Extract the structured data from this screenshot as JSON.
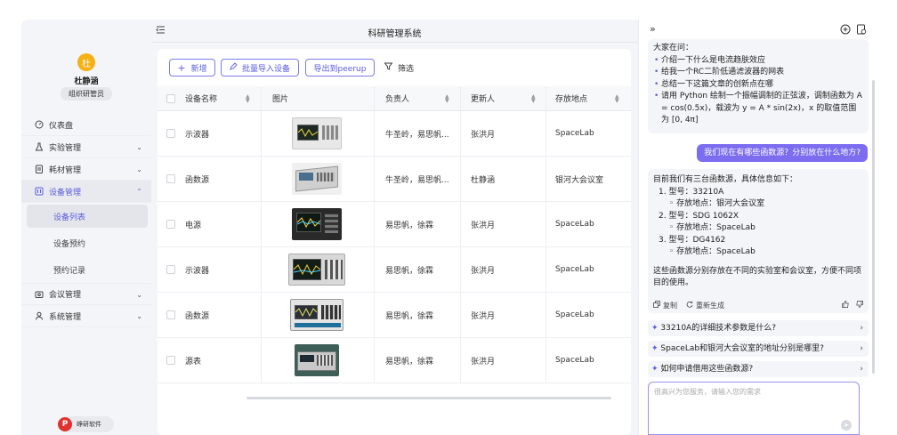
{
  "app": {
    "title": "科研管理系统"
  },
  "user": {
    "avatar_char": "杜",
    "name": "杜静涵",
    "role": "组织研管员"
  },
  "sidebar": {
    "items": [
      {
        "label": "仪表盘",
        "icon": "dashboard-icon"
      },
      {
        "label": "实验管理",
        "icon": "flask-icon"
      },
      {
        "label": "耗材管理",
        "icon": "clipboard-icon"
      },
      {
        "label": "设备管理",
        "icon": "device-icon"
      },
      {
        "label": "会议管理",
        "icon": "meeting-icon"
      },
      {
        "label": "系统管理",
        "icon": "user-icon"
      }
    ],
    "sub_items": [
      "设备列表",
      "设备预约",
      "预约记录"
    ]
  },
  "brand": {
    "logo_char": "P",
    "label": "峥研软件"
  },
  "toolbar": {
    "add_label": "新增",
    "import_label": "批量导入设备",
    "export_label": "导出到peerup",
    "filter_label": "筛选"
  },
  "table": {
    "headers": [
      "设备名称",
      "图片",
      "负责人",
      "更新人",
      "存放地点"
    ],
    "rows": [
      {
        "name": "示波器",
        "owner": "牛圣岭，易思帆...",
        "updater": "张洪月",
        "location": "SpaceLab"
      },
      {
        "name": "函数源",
        "owner": "牛圣岭，易思帆...",
        "updater": "杜静涵",
        "location": "银河大会议室"
      },
      {
        "name": "电源",
        "owner": "易思帆，徐霖",
        "updater": "张洪月",
        "location": "SpaceLab"
      },
      {
        "name": "示波器",
        "owner": "易思帆，徐霖",
        "updater": "张洪月",
        "location": "SpaceLab"
      },
      {
        "name": "函数源",
        "owner": "易思帆，徐霖",
        "updater": "张洪月",
        "location": "SpaceLab"
      },
      {
        "name": "源表",
        "owner": "易思帆，徐霖",
        "updater": "张洪月",
        "location": "SpaceLab"
      }
    ]
  },
  "chat": {
    "intro_title": "大家在问：",
    "intro_items": [
      "介绍一下什么是电流趋肤效应",
      "给我一个RC二阶低通滤波器的网表",
      "总结一下这篇文章的创新点在哪",
      "请用 Python 绘制一个振幅调制的正弦波，调制函数为 A = cos(0.5x)，载波为 y = A * sin(2x)，x 的取值范围为 [0, 4π]"
    ],
    "user_question": "我们现在有哪些函数源？分别放在什么地方?",
    "answer_intro": "目前我们有三台函数源，具体信息如下：",
    "answer_items": [
      {
        "model": "1. 型号：33210A",
        "place": "存放地点：银河大会议室"
      },
      {
        "model": "2. 型号：SDG 1062X",
        "place": "存放地点：SpaceLab"
      },
      {
        "model": "3. 型号：DG4162",
        "place": "存放地点：SpaceLab"
      }
    ],
    "answer_outro": "这些函数源分别存放在不同的实验室和会议室，方便不同项目的使用。",
    "copy_label": "复制",
    "regen_label": "重新生成",
    "suggestions": [
      "33210A的详细技术参数是什么?",
      "SpaceLab和银河大会议室的地址分别是哪里?",
      "如何申请借用这些函数源?"
    ],
    "input_placeholder": "很高兴为您服务，请输入您的需求"
  }
}
